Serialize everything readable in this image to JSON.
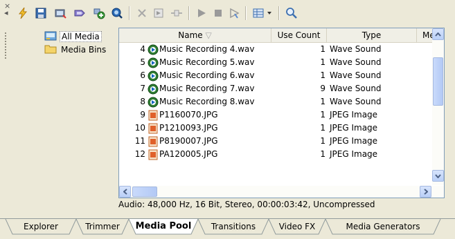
{
  "toolbar": {
    "close_glyph": "×",
    "buttons": [
      {
        "name": "lightning-icon",
        "color": "#e2a012"
      },
      {
        "name": "save-icon",
        "color": "#3c6fb0"
      },
      {
        "name": "capture-icon",
        "color": "#6b7f9e"
      },
      {
        "name": "get-media-icon",
        "color": "#6b5fb0"
      },
      {
        "name": "add-media-icon",
        "color": "#3a9b3a"
      },
      {
        "name": "media-fx-icon",
        "color": "#2a6ab5"
      },
      {
        "name": "remove-icon",
        "color": "#9a9a9a"
      },
      {
        "name": "properties-icon",
        "color": "#9a9a9a"
      },
      {
        "name": "split-icon",
        "color": "#9a9a9a"
      },
      {
        "name": "play-icon",
        "color": "#9a9a9a"
      },
      {
        "name": "stop-icon",
        "color": "#9a9a9a"
      },
      {
        "name": "auto-preview-icon",
        "color": "#9a9a9a"
      },
      {
        "name": "views-icon",
        "color": "#3c6fb0"
      },
      {
        "name": "search-icon",
        "color": "#3c6fb0"
      }
    ]
  },
  "tree": {
    "items": [
      {
        "label": "All Media",
        "icon": "all-media-icon",
        "selected": true
      },
      {
        "label": "Media Bins",
        "icon": "folder-icon",
        "selected": false
      }
    ]
  },
  "list": {
    "columns": [
      {
        "label": "Name",
        "sort": "desc"
      },
      {
        "label": "Use Count"
      },
      {
        "label": "Type"
      },
      {
        "label": "Me"
      }
    ],
    "rows": [
      {
        "num": "4",
        "name": "Music Recording 4.wav",
        "count": "1",
        "type": "Wave Sound",
        "kind": "audio"
      },
      {
        "num": "5",
        "name": "Music Recording 5.wav",
        "count": "1",
        "type": "Wave Sound",
        "kind": "audio"
      },
      {
        "num": "6",
        "name": "Music Recording 6.wav",
        "count": "1",
        "type": "Wave Sound",
        "kind": "audio"
      },
      {
        "num": "7",
        "name": "Music Recording 7.wav",
        "count": "9",
        "type": "Wave Sound",
        "kind": "audio"
      },
      {
        "num": "8",
        "name": "Music Recording 8.wav",
        "count": "1",
        "type": "Wave Sound",
        "kind": "audio"
      },
      {
        "num": "9",
        "name": "P1160070.JPG",
        "count": "1",
        "type": "JPEG Image",
        "kind": "image"
      },
      {
        "num": "10",
        "name": "P1210093.JPG",
        "count": "1",
        "type": "JPEG Image",
        "kind": "image"
      },
      {
        "num": "11",
        "name": "P8190007.JPG",
        "count": "1",
        "type": "JPEG Image",
        "kind": "image"
      },
      {
        "num": "12",
        "name": "PA120005.JPG",
        "count": "1",
        "type": "JPEG Image",
        "kind": "image"
      }
    ]
  },
  "status": "Audio: 48,000 Hz, 16 Bit, Stereo, 00:00:03:42, Uncompressed",
  "tabs": [
    {
      "label": "Explorer",
      "active": false
    },
    {
      "label": "Trimmer",
      "active": false
    },
    {
      "label": "Media Pool",
      "active": true
    },
    {
      "label": "Transitions",
      "active": false
    },
    {
      "label": "Video FX",
      "active": false
    },
    {
      "label": "Media Generators",
      "active": false
    }
  ]
}
